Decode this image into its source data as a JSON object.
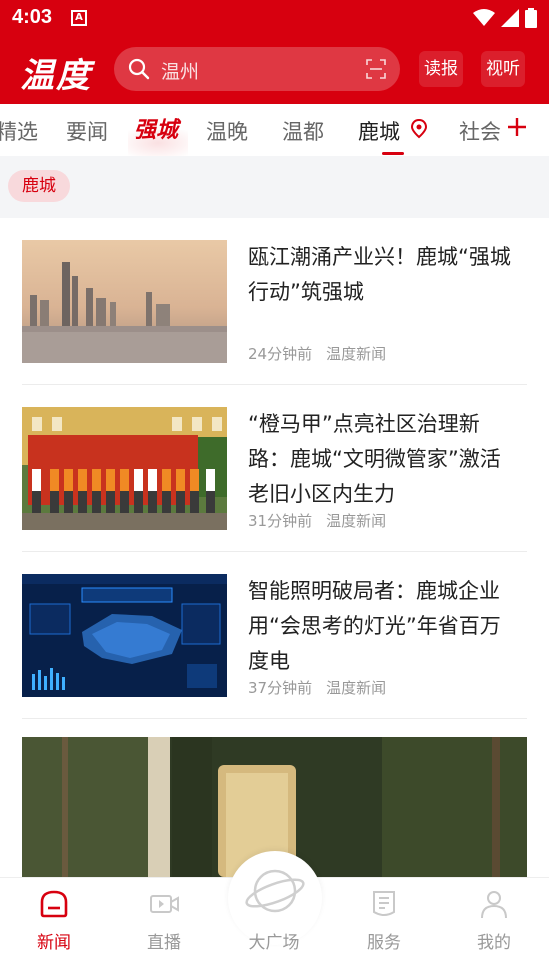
{
  "status": {
    "time": "4:03",
    "notif_letter": "A"
  },
  "header": {
    "logo": "温度",
    "search_placeholder": "温州",
    "btn_read": "读报",
    "btn_video": "视听"
  },
  "tabs": [
    {
      "label": "精选"
    },
    {
      "label": "要闻"
    },
    {
      "label": "强城"
    },
    {
      "label": "温晚"
    },
    {
      "label": "温都"
    },
    {
      "label": "鹿城"
    },
    {
      "label": "社会"
    }
  ],
  "active_tab": "鹿城",
  "subbar": {
    "chip": "鹿城"
  },
  "news": [
    {
      "title": "瓯江潮涌产业兴！鹿城“强城行动”筑强城",
      "time": "24分钟前",
      "source": "温度新闻"
    },
    {
      "title": "“橙马甲”点亮社区治理新路：鹿城“文明微管家”激活老旧小区内生力",
      "time": "31分钟前",
      "source": "温度新闻"
    },
    {
      "title": "智能照明破局者：鹿城企业用“会思考的灯光”年省百万度电",
      "time": "37分钟前",
      "source": "温度新闻"
    }
  ],
  "bottom_nav": [
    {
      "label": "新闻",
      "icon": "news-icon",
      "active": true
    },
    {
      "label": "直播",
      "icon": "live-icon",
      "active": false
    },
    {
      "label": "大广场",
      "icon": "planet-icon",
      "active": false
    },
    {
      "label": "服务",
      "icon": "service-icon",
      "active": false
    },
    {
      "label": "我的",
      "icon": "profile-icon",
      "active": false
    }
  ],
  "colors": {
    "brand": "#d7000f",
    "chip_bg": "#f8d9dc"
  }
}
